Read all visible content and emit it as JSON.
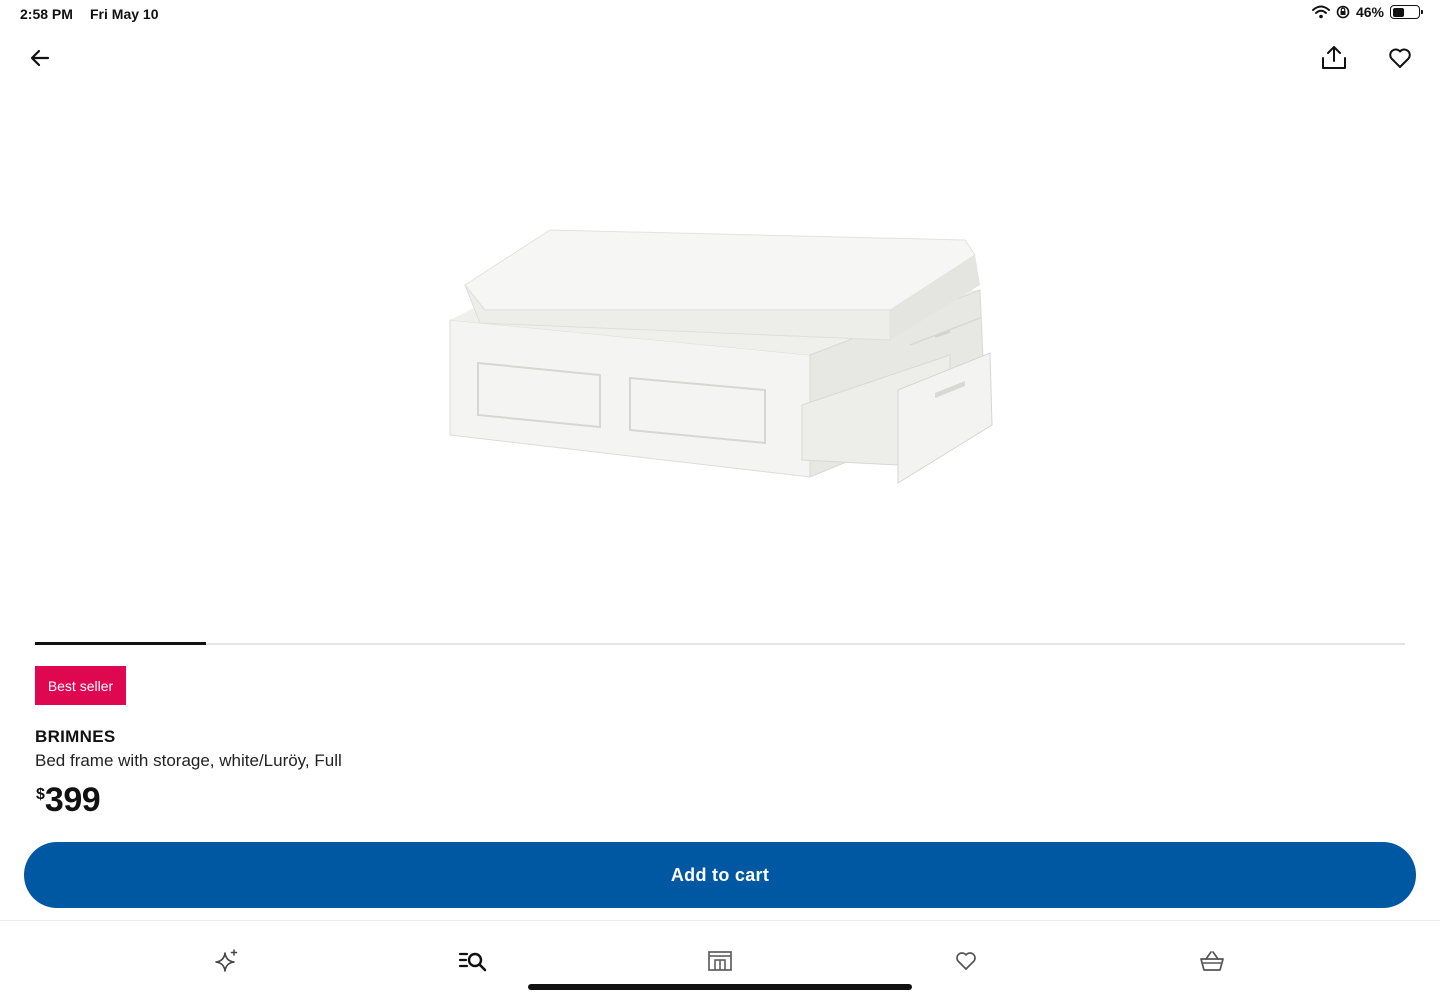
{
  "status_bar": {
    "time": "2:58 PM",
    "date": "Fri May 10",
    "battery_percent": "46%",
    "battery_level": 0.46
  },
  "top_nav": {
    "back_icon": "arrow-left-icon",
    "share_icon": "share-icon",
    "favorite_icon": "heart-icon"
  },
  "product": {
    "image": "white-bed-frame-with-storage-drawers",
    "image_carousel_progress": 0.125,
    "badge": "Best seller",
    "name": "BRIMNES",
    "description": "Bed frame with storage, white/Luröy, Full",
    "price_currency": "$",
    "price_amount": "399"
  },
  "actions": {
    "add_to_cart_label": "Add to cart"
  },
  "tab_bar": {
    "tabs": [
      {
        "icon": "sparkle-icon"
      },
      {
        "icon": "search-list-icon",
        "active": true
      },
      {
        "icon": "store-icon"
      },
      {
        "icon": "heart-icon"
      },
      {
        "icon": "basket-icon"
      }
    ]
  },
  "colors": {
    "brand_blue": "#0058a3",
    "badge_red": "#e00751",
    "text": "#111111"
  }
}
